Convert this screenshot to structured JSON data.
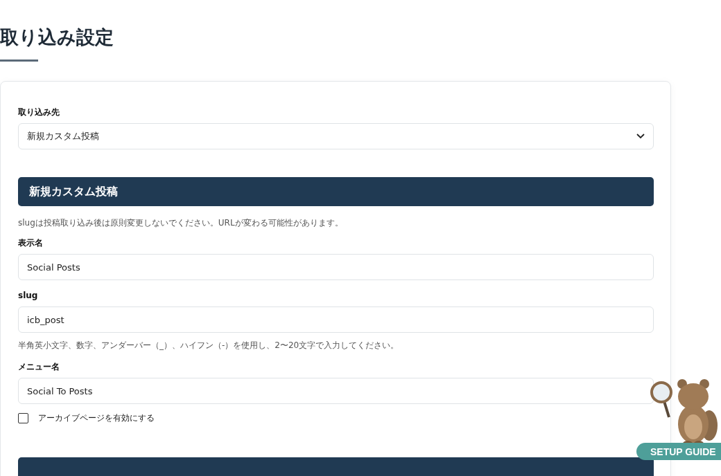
{
  "page_title": "取り込み設定",
  "destination": {
    "label": "取り込み先",
    "value": "新規カスタム投稿"
  },
  "section": {
    "title": "新規カスタム投稿",
    "note": "slugは投稿取り込み後は原則変更しないでください。URLが変わる可能性があります。",
    "fields": [
      {
        "label": "表示名",
        "value": "Social Posts"
      },
      {
        "label": "slug",
        "value": "icb_post",
        "help": "半角英小文字、数字、アンダーバー（_）、ハイフン（-）を使用し、2〜20文字で入力してください。"
      },
      {
        "label": "メニュー名",
        "value": "Social To Posts"
      }
    ],
    "archive": {
      "label": "アーカイブページを有効にする",
      "checked": false
    }
  },
  "guide_button": {
    "label": "SETUP GUIDE"
  }
}
